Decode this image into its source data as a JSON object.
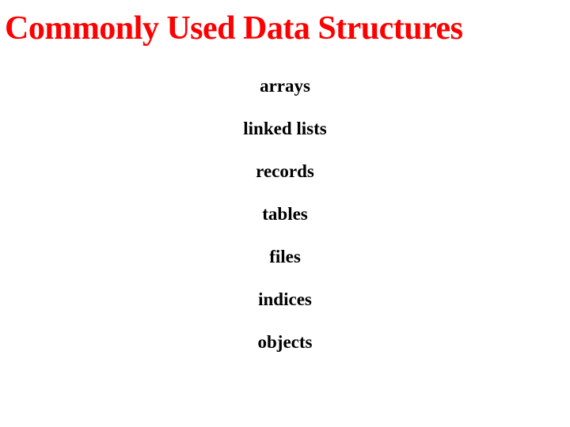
{
  "title": "Commonly Used Data Structures",
  "items": [
    "arrays",
    "linked lists",
    "records",
    "tables",
    "files",
    "indices",
    "objects"
  ]
}
